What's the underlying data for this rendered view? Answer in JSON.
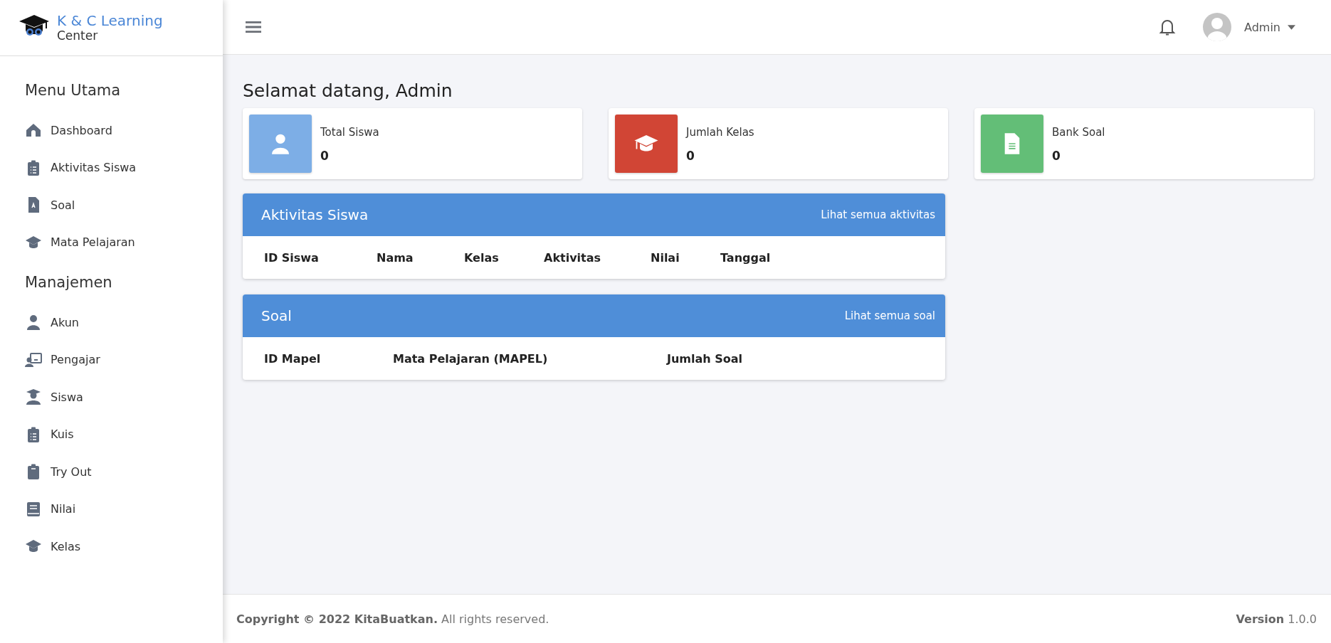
{
  "brand": {
    "title": "K & C Learning",
    "subtitle": "Center"
  },
  "sidebar": {
    "sections": [
      {
        "heading": "Menu Utama",
        "items": [
          {
            "label": "Dashboard"
          },
          {
            "label": "Aktivitas Siswa"
          },
          {
            "label": "Soal"
          },
          {
            "label": "Mata Pelajaran"
          }
        ]
      },
      {
        "heading": "Manajemen",
        "items": [
          {
            "label": "Akun"
          },
          {
            "label": "Pengajar"
          },
          {
            "label": "Siswa"
          },
          {
            "label": "Kuis"
          },
          {
            "label": "Try Out"
          },
          {
            "label": "Nilai"
          },
          {
            "label": "Kelas"
          }
        ]
      }
    ]
  },
  "header": {
    "user": "Admin"
  },
  "greeting": "Selamat datang, Admin",
  "stats": [
    {
      "label": "Total Siswa",
      "value": "0",
      "color": "#7daee6"
    },
    {
      "label": "Jumlah Kelas",
      "value": "0",
      "color": "#d14535"
    },
    {
      "label": "Bank Soal",
      "value": "0",
      "color": "#63be77"
    }
  ],
  "tables": [
    {
      "title": "Aktivitas Siswa",
      "link": "Lihat semua aktivitas",
      "columns": [
        "ID Siswa",
        "Nama",
        "Kelas",
        "Aktivitas",
        "Nilai",
        "Tanggal"
      ]
    },
    {
      "title": "Soal",
      "link": "Lihat semua soal",
      "columns": [
        "ID Mapel",
        "Mata Pelajaran (MAPEL)",
        "Jumlah Soal"
      ]
    }
  ],
  "footer": {
    "copyright": "**Copyright © 2022 KitaBuatkan.** All rights reserved.",
    "version": "**Version** 1.0.0"
  }
}
